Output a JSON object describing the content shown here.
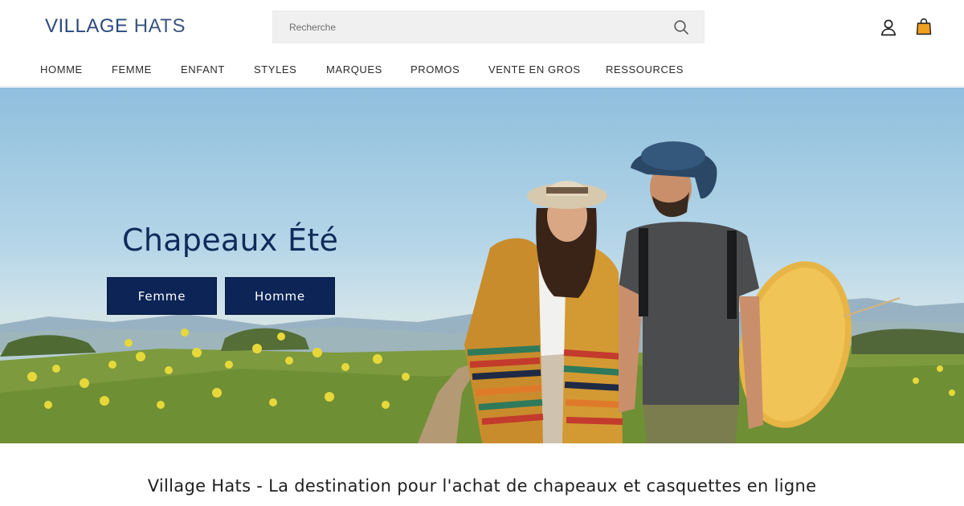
{
  "header": {
    "logo": {
      "bold": "VILLAGE",
      "light": "HATS"
    },
    "search": {
      "placeholder": "Recherche",
      "icon": "search-icon"
    },
    "account_icon": "account-icon",
    "cart_icon": "shopping-bag-icon"
  },
  "nav": {
    "items": [
      {
        "label": "HOMME"
      },
      {
        "label": "FEMME"
      },
      {
        "label": "ENFANT"
      },
      {
        "label": "STYLES"
      },
      {
        "label": "MARQUES"
      },
      {
        "label": "PROMOS"
      },
      {
        "label": "VENTE EN GROS"
      },
      {
        "label": "RESSOURCES"
      }
    ]
  },
  "hero": {
    "title": "Chapeaux Été",
    "buttons": {
      "femme": "Femme",
      "homme": "Homme"
    }
  },
  "tagline": "Village Hats - La destination pour l'achat de chapeaux et casquettes en ligne",
  "colors": {
    "logo": "#2b4a7e",
    "hero_button": "#0c2456",
    "hero_title": "#0f2b5b",
    "cart_accent": "#f0a020"
  }
}
